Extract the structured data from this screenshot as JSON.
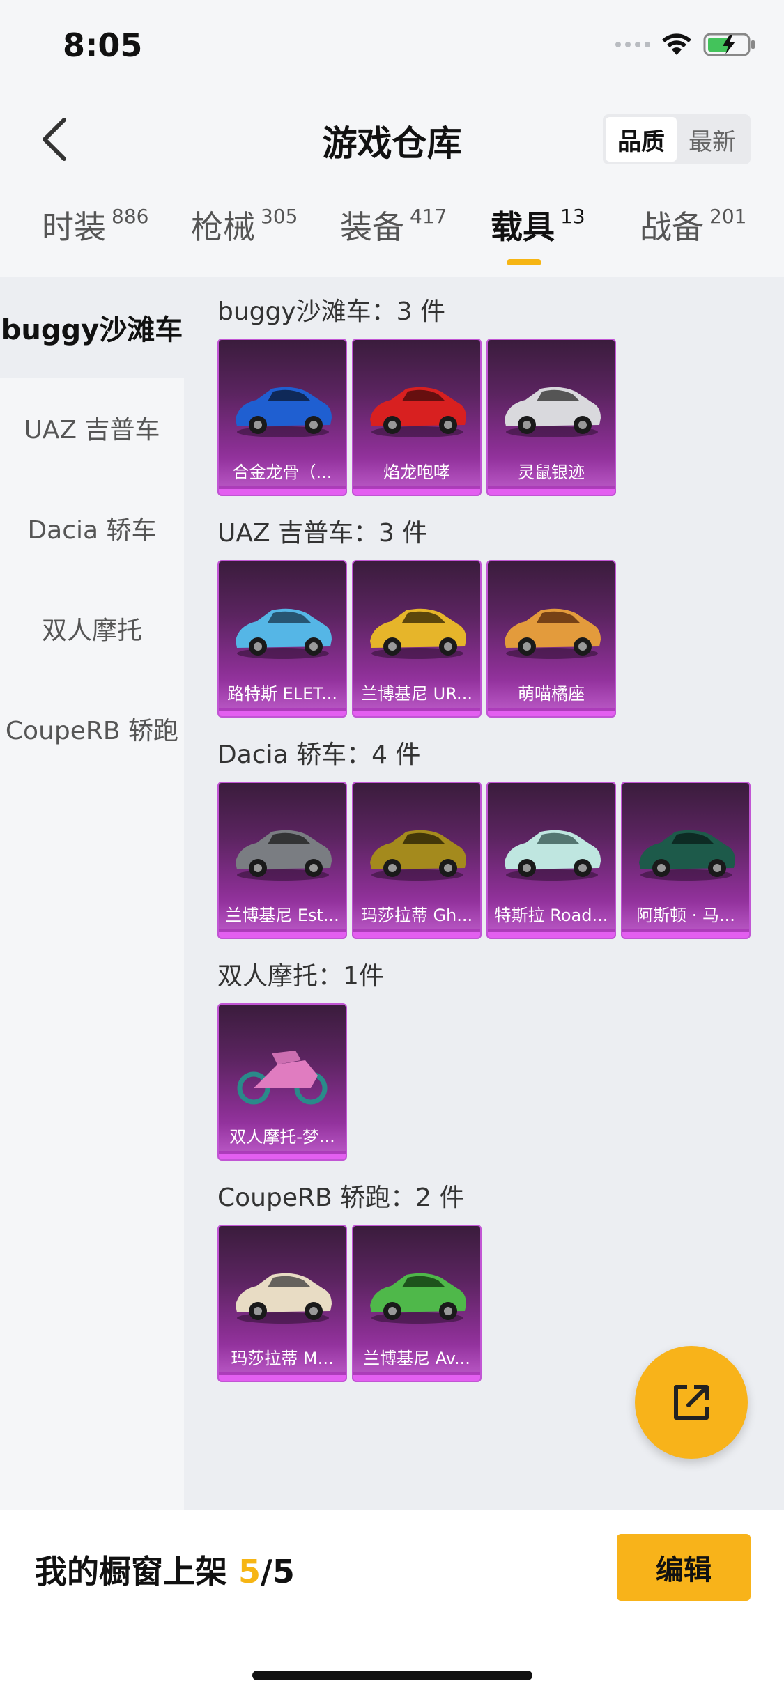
{
  "status": {
    "time": "8:05"
  },
  "nav": {
    "title": "游戏仓库",
    "sort_options": [
      "品质",
      "最新"
    ]
  },
  "tabs": [
    {
      "label": "时装",
      "count": "886"
    },
    {
      "label": "枪械",
      "count": "305"
    },
    {
      "label": "装备",
      "count": "417"
    },
    {
      "label": "载具",
      "count": "13"
    },
    {
      "label": "战备",
      "count": "201"
    }
  ],
  "sidebar": [
    "buggy沙滩车",
    "UAZ 吉普车",
    "Dacia 轿车",
    "双人摩托",
    "CoupeRB 轿跑"
  ],
  "groups": [
    {
      "title": "buggy沙滩车：3 件",
      "items": [
        "合金龙骨（...",
        "焰龙咆哮",
        "灵鼠银迹"
      ]
    },
    {
      "title": "UAZ 吉普车：3 件",
      "items": [
        "路特斯 ELET...",
        "兰博基尼 UR...",
        "萌喵橘座"
      ]
    },
    {
      "title": "Dacia 轿车：4 件",
      "items": [
        "兰博基尼 Est...",
        "玛莎拉蒂 Gh...",
        "特斯拉 Road...",
        "阿斯顿 · 马..."
      ]
    },
    {
      "title": "双人摩托：1件",
      "items": [
        "双人摩托-梦..."
      ]
    },
    {
      "title": "CoupeRB 轿跑：2 件",
      "items": [
        "玛莎拉蒂 M...",
        "兰博基尼 Av..."
      ]
    }
  ],
  "colors": {
    "accent": "#f6b514",
    "card_top": "#3a1c3c",
    "card_bottom": "#b23fc0",
    "car_colors": [
      [
        "#1f5fd1",
        "#0b1b3a"
      ],
      [
        "#d82020",
        "#4a0b0b"
      ],
      [
        "#d9d9dd",
        "#333"
      ],
      [
        "#55b6e6",
        "#1b3d55"
      ],
      [
        "#e6b52a",
        "#3a2a05"
      ],
      [
        "#e39b3c",
        "#5a2a0c"
      ],
      [
        "#7a7d82",
        "#222"
      ],
      [
        "#a48a1d",
        "#2a2205"
      ],
      [
        "#bfe6e0",
        "#3a5a55"
      ],
      [
        "#1d5a4a",
        "#0a1f1a"
      ],
      [
        "#e07cc0",
        "#2a8a8a"
      ],
      [
        "#e8dcc4",
        "#444"
      ],
      [
        "#4fb84a",
        "#123a10"
      ]
    ]
  },
  "bottom": {
    "shelf_label": "我的橱窗上架 ",
    "shelf_count": "5",
    "shelf_total": "/5",
    "edit_label": "编辑"
  }
}
